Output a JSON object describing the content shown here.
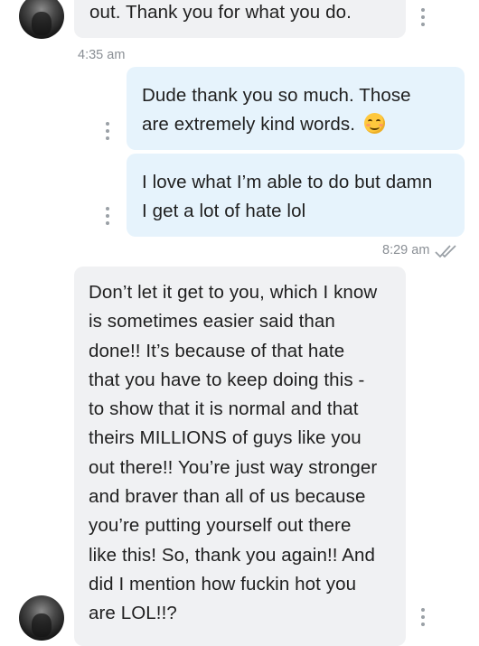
{
  "messages": [
    {
      "direction": "incoming",
      "lines": [
        "out. Thank you for what you do."
      ],
      "timestamp": "4:35 am"
    },
    {
      "direction": "outgoing",
      "lines": [
        "Dude thank you so much. Those",
        "are extremely kind words."
      ],
      "emoji": "smiling-face-icon"
    },
    {
      "direction": "outgoing",
      "lines": [
        "I love what I’m able to do but damn",
        "I get a lot of hate lol"
      ],
      "timestamp": "8:29 am",
      "status": "read"
    },
    {
      "direction": "incoming",
      "lines": [
        "Don’t let it get to you, which I know",
        "is sometimes easier said than",
        "done!! It’s because of that hate",
        "that you have to keep doing this -",
        "to show that it is normal and that",
        "theirs MILLIONS of guys like you",
        "out there!! You’re just way stronger",
        "and braver than all of us because",
        "you’re putting yourself out there",
        "like this! So, thank you again!! And",
        "did I mention how fuckin hot you",
        "are LOL!!?"
      ]
    }
  ],
  "icons": {
    "avatar": "avatar",
    "menu": "more-vert-icon",
    "read_receipt": "double-check-icon"
  },
  "colors": {
    "incoming_bubble": "#f0f1f3",
    "outgoing_bubble": "#e6f3fc",
    "timestamp": "#8a8f95",
    "text": "#1f1f1f"
  }
}
